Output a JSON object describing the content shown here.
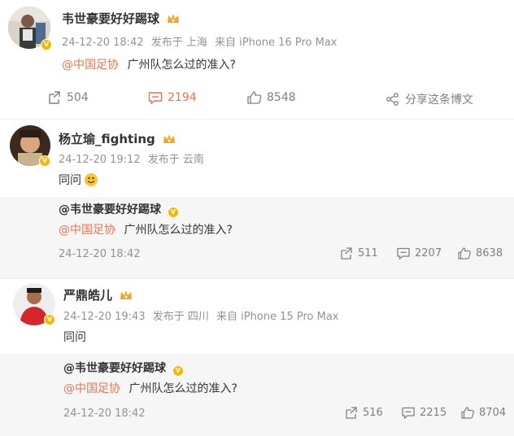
{
  "post1": {
    "author": "韦世豪要好好踢球",
    "time": "24-12-20 18:42",
    "location": "发布于 上海",
    "device": "来自 iPhone 16 Pro Max",
    "mention": "@中国足协",
    "text": "广州队怎么过的准入?",
    "reposts": "504",
    "comments": "2194",
    "likes": "8548",
    "share_label": "分享这条博文",
    "accent_color": "#eb7350"
  },
  "post2": {
    "author": "杨立瑜_fighting",
    "time": "24-12-20 19:12",
    "location": "发布于 云南",
    "text": "同问",
    "repost": {
      "author": "@韦世豪要好好踢球",
      "mention": "@中国足协",
      "text": "广州队怎么过的准入?",
      "time": "24-12-20 18:42",
      "reposts": "511",
      "comments": "2207",
      "likes": "8638"
    }
  },
  "post3": {
    "author": "严鼎皓儿",
    "time": "24-12-20 19:43",
    "location": "发布于 四川",
    "device": "来自 iPhone 15 Pro Max",
    "text": "同问",
    "repost": {
      "author": "@韦世豪要好好踢球",
      "mention": "@中国足协",
      "text": "广州队怎么过的准入?",
      "time": "24-12-20 18:42",
      "reposts": "516",
      "comments": "2215",
      "likes": "8704"
    }
  },
  "icons": {
    "repost": "repost-icon",
    "comment": "comment-icon",
    "like": "thumbs-up-icon",
    "share": "share-icon",
    "verified": "verified-badge-icon",
    "crown": "crown-icon",
    "emoji": "smile-emoji-icon"
  }
}
